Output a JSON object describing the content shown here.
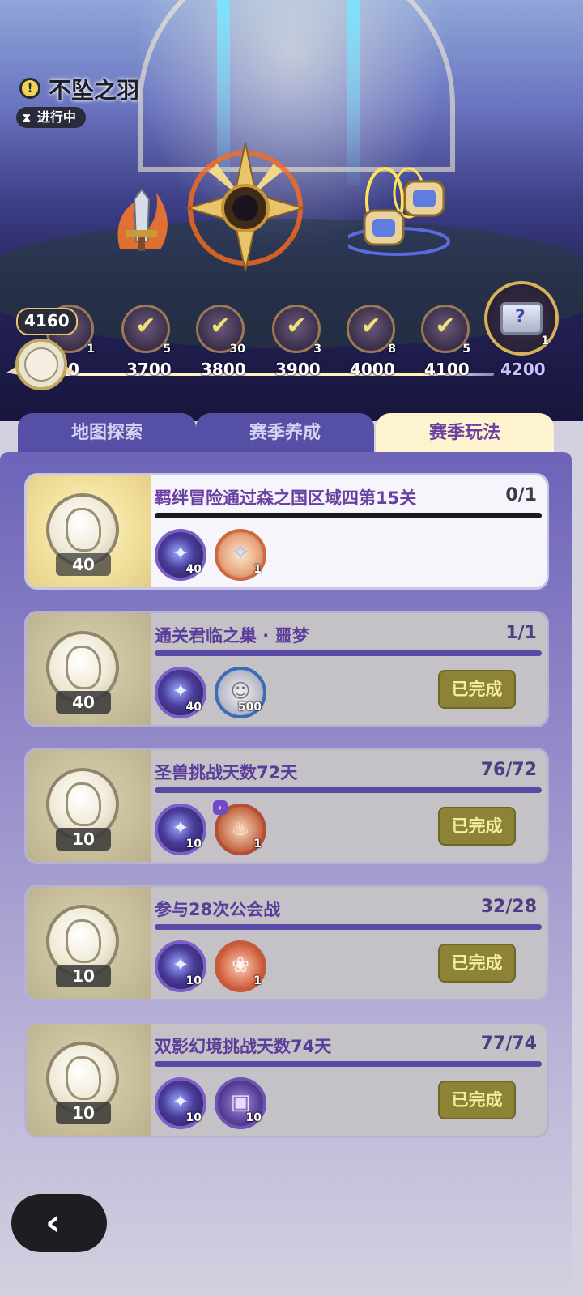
{
  "event": {
    "title": "不坠之羽",
    "status": "进行中"
  },
  "track": {
    "current_points": "4160",
    "partial_label": "0",
    "nodes": [
      {
        "count": "1",
        "points": "3700"
      },
      {
        "count": "5",
        "points": "3800"
      },
      {
        "count": "30",
        "points": "3900"
      },
      {
        "count": "3",
        "points": "4000"
      },
      {
        "count": "8",
        "points": "4100"
      },
      {
        "count": "5",
        "points": "4200"
      }
    ],
    "node_counts": [
      "1",
      "5",
      "30",
      "3",
      "8",
      "5"
    ],
    "point_labels": [
      "3700",
      "3800",
      "3900",
      "4000",
      "4100",
      "4200"
    ],
    "chest_count": "1"
  },
  "tabs": [
    "地图探索",
    "赛季养成",
    "赛季玩法"
  ],
  "active_tab": "赛季玩法",
  "tasks": [
    {
      "title": "羁绊冒险通过森之国区域四第15关",
      "progress": "0/1",
      "coin": "40",
      "item1": "40",
      "item2": "1",
      "done_label": ""
    },
    {
      "title": "通关君临之巢 · 噩梦",
      "progress": "1/1",
      "coin": "40",
      "item1": "40",
      "item2": "500",
      "done_label": "已完成"
    },
    {
      "title": "圣兽挑战天数72天",
      "progress": "76/72",
      "coin": "10",
      "item1": "10",
      "item2": "1",
      "done_label": "已完成"
    },
    {
      "title": "参与28次公会战",
      "progress": "32/28",
      "coin": "10",
      "item1": "10",
      "item2": "1",
      "done_label": "已完成"
    },
    {
      "title": "双影幻境挑战天数74天",
      "progress": "77/74",
      "coin": "10",
      "item1": "10",
      "item2": "10",
      "done_label": "已完成"
    }
  ],
  "icons": {
    "info": "exclamation-icon",
    "status": "hourglass-icon",
    "check": "checkmark-icon",
    "back": "back-arrow-icon"
  },
  "colors": {
    "tab_active": "#fdf3cf",
    "tab_inactive": "#564fa6",
    "title_purple": "#6a3fa0",
    "done_button": "#8c8336"
  }
}
